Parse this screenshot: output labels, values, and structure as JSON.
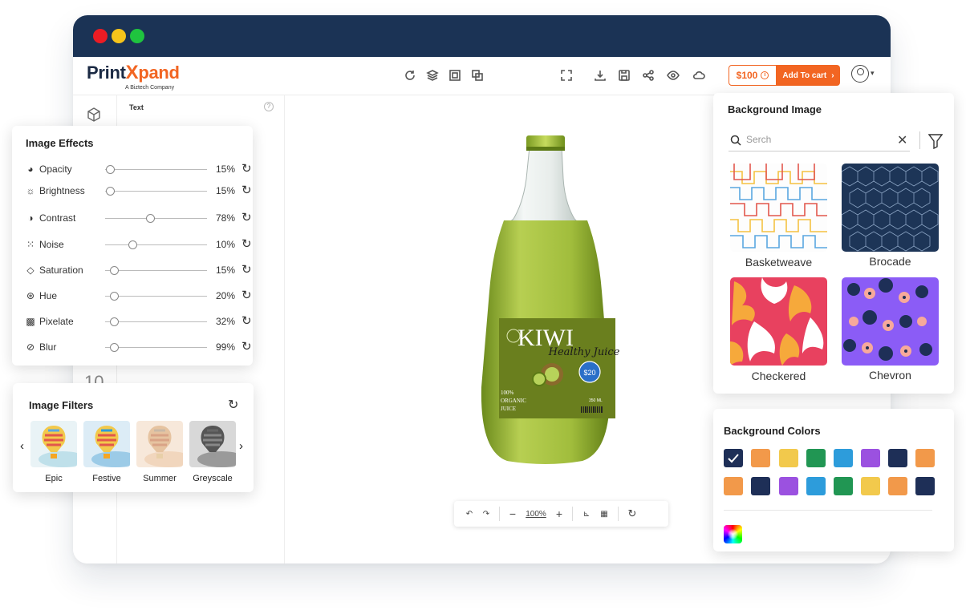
{
  "app": {
    "brand": "PrintXpand",
    "brand_sub": "A Biztech Company",
    "price": "$100",
    "add_to_cart": "Add To cart",
    "sidebar_panel_title": "Text",
    "sidebar_number": "10"
  },
  "canvas": {
    "zoom": "100%",
    "label": {
      "brand": "KIWI",
      "tagline": "Healthy Juice",
      "price_badge": "$20",
      "lines": [
        "100%",
        "ORGANIC",
        "JUICE"
      ],
      "volume": "350 ML"
    }
  },
  "image_effects": {
    "title": "Image Effects",
    "rows": [
      {
        "label": "Opacity",
        "value": "15%",
        "level": 0.05,
        "icon": "opacity-icon"
      },
      {
        "label": "Brightness",
        "value": "15%",
        "level": 0.05,
        "icon": "brightness-icon"
      },
      {
        "label": "Contrast",
        "value": "78%",
        "level": 0.44,
        "icon": "contrast-icon"
      },
      {
        "label": "Noise",
        "value": "10%",
        "level": 0.27,
        "icon": "noise-icon"
      },
      {
        "label": "Saturation",
        "value": "15%",
        "level": 0.09,
        "icon": "saturation-icon"
      },
      {
        "label": "Hue",
        "value": "20%",
        "level": 0.09,
        "icon": "hue-icon"
      },
      {
        "label": "Pixelate",
        "value": "32%",
        "level": 0.09,
        "icon": "pixelate-icon"
      },
      {
        "label": "Blur",
        "value": "99%",
        "level": 0.09,
        "icon": "blur-icon"
      }
    ]
  },
  "image_filters": {
    "title": "Image Filters",
    "items": [
      "Epic",
      "Festive",
      "Summer",
      "Greyscale"
    ]
  },
  "background_image": {
    "title": "Background Image",
    "search_placeholder": "Serch",
    "patterns": [
      "Basketweave",
      "Brocade",
      "Checkered",
      "Chevron"
    ]
  },
  "background_colors": {
    "title": "Background Colors",
    "selected": 0,
    "row1": [
      "#1e2f57",
      "#f2994a",
      "#f2c94c",
      "#219653",
      "#2d9cdb",
      "#9b51e0",
      "#1e2f57",
      "#f2994a"
    ],
    "row2": [
      "#f2994a",
      "#1e2f57",
      "#9b51e0",
      "#2d9cdb",
      "#219653",
      "#f2c94c",
      "#f2994a",
      "#1e2f57"
    ]
  },
  "colors": {
    "titlebar": "#1b3355",
    "accent": "#f26522"
  }
}
